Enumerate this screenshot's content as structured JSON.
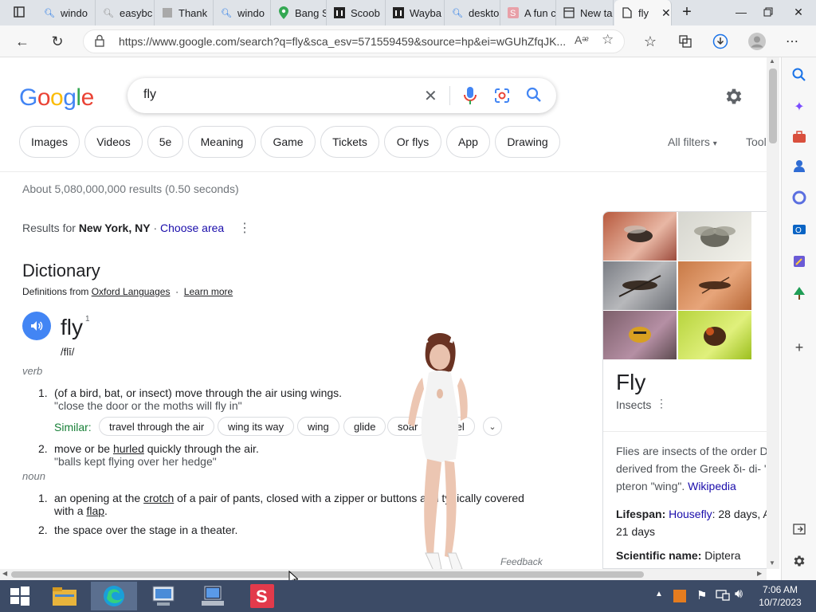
{
  "browser": {
    "tabs": [
      {
        "label": "windo",
        "icon": "search-icon"
      },
      {
        "label": "easybc",
        "icon": "search-icon"
      },
      {
        "label": "Thank",
        "icon": "page-icon"
      },
      {
        "label": "windo",
        "icon": "search-icon"
      },
      {
        "label": "Bang S",
        "icon": "maps-icon"
      },
      {
        "label": "Scoob",
        "icon": "museum-icon"
      },
      {
        "label": "Wayba",
        "icon": "museum-icon"
      },
      {
        "label": "deskto",
        "icon": "search-icon"
      },
      {
        "label": "A fun c",
        "icon": "s-icon"
      },
      {
        "label": "New ta",
        "icon": "newtab-icon"
      },
      {
        "label": "fly",
        "icon": "doc-icon"
      }
    ],
    "url": "https://www.google.com/search?q=fly&sca_esv=571559459&source=hp&ei=wGUhZfqJK..."
  },
  "google": {
    "logo": "Google",
    "query": "fly",
    "chips": [
      "Images",
      "Videos",
      "5e",
      "Meaning",
      "Game",
      "Tickets",
      "Or flys",
      "App",
      "Drawing"
    ],
    "all_filters": "All filters",
    "tools": "Tool",
    "result_stats": "About 5,080,000,000 results (0.50 seconds)",
    "results_for_prefix": "Results for ",
    "location": "New York, NY",
    "choose_area": "Choose area",
    "colors": {
      "link": "#1a0dab",
      "accent": "#4285f4",
      "green": "#188038"
    }
  },
  "dictionary": {
    "heading": "Dictionary",
    "definitions_from": "Definitions from ",
    "source": "Oxford Languages",
    "learn_more": "Learn more",
    "word": "fly",
    "superscript": "1",
    "phonetic": "/flī/",
    "pos1": "verb",
    "def1_num": "1.",
    "def1": "(of a bird, bat, or insect) move through the air using wings.",
    "def1_example": "\"close the door or the moths will fly in\"",
    "similar_label": "Similar:",
    "similar": [
      "travel through the air",
      "wing its way",
      "wing",
      "glide",
      "soar",
      "travel"
    ],
    "def2_num": "2.",
    "def2_a": "move or be ",
    "def2_link": "hurled",
    "def2_b": " quickly through the air.",
    "def2_example": "\"balls kept flying over her hedge\"",
    "pos2": "noun",
    "n1_num": "1.",
    "n1_a": "an opening at the ",
    "n1_link": "crotch",
    "n1_b": " of a pair of pants, closed with a zipper or buttons and typically covered",
    "n1_c": "with a ",
    "n1_link2": "flap",
    "n1_d": ".",
    "n2_num": "2.",
    "n2": "the space over the stage in a theater.",
    "feedback": "Feedback"
  },
  "knowledge_panel": {
    "title": "Fly",
    "subtitle": "Insects",
    "desc1": "Flies are insects of the order D",
    "desc2": "derived from the Greek δι- di- \"",
    "desc3_a": "pteron \"wing\". ",
    "desc3_link": "Wikipedia",
    "lifespan_label": "Lifespan: ",
    "lifespan_link": "Housefly",
    "lifespan_val": ": 28 days, A",
    "lifespan_val2": "21 days",
    "sci_label": "Scientific name: ",
    "sci_val": "Diptera"
  },
  "taskbar": {
    "time": "7:06 AM",
    "date": "10/7/2023"
  }
}
